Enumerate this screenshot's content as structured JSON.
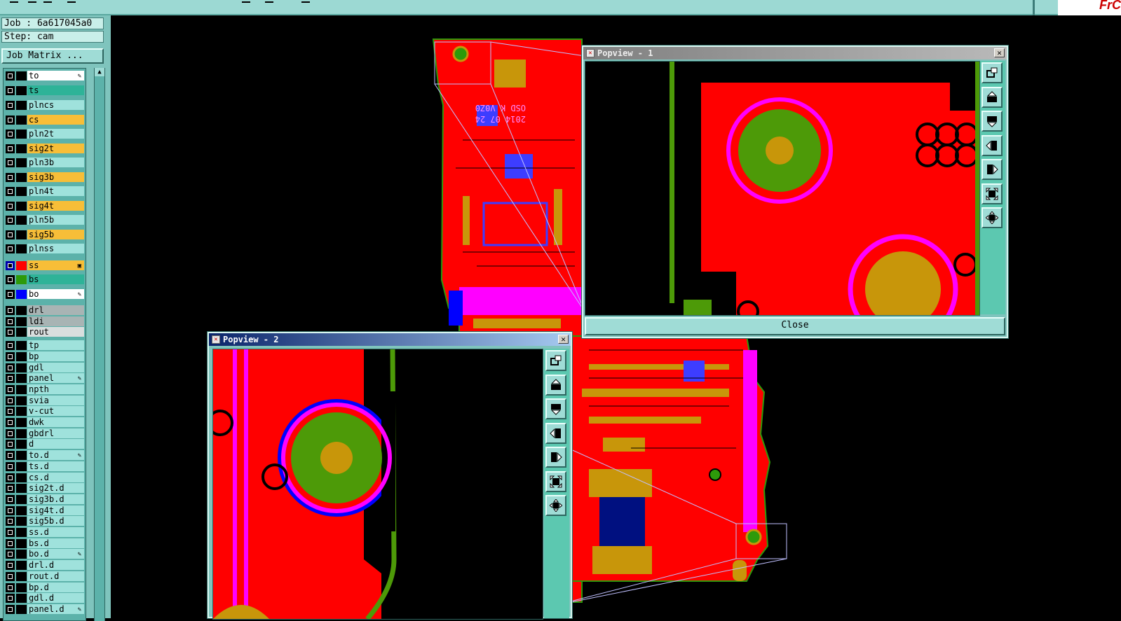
{
  "job_label": "Job : 6a617045a0",
  "step_label": "Step: cam",
  "job_matrix_button": "Job Matrix ...",
  "colors": {
    "panel": "#7fc4bd",
    "layer_default": "#9fe2dc",
    "signal_layer": "#f7be38",
    "selected_layer": "#2eb398",
    "board_red": "#ff0000",
    "pad_gold": "#c8960a",
    "green": "#4d9a08",
    "magenta": "#ff00ff"
  },
  "layers": [
    {
      "name": "to",
      "color": "white",
      "chip": "#000",
      "mark": "✎"
    },
    {
      "name": "ts",
      "color": "teal",
      "chip": "#000",
      "mark": ""
    },
    {
      "name": "plncs",
      "color": "default",
      "chip": "#000",
      "mark": ""
    },
    {
      "name": "cs",
      "color": "orange",
      "chip": "#000",
      "mark": ""
    },
    {
      "name": "pln2t",
      "color": "default",
      "chip": "#000",
      "mark": ""
    },
    {
      "name": "sig2t",
      "color": "orange",
      "chip": "#000",
      "mark": ""
    },
    {
      "name": "pln3b",
      "color": "default",
      "chip": "#000",
      "mark": ""
    },
    {
      "name": "sig3b",
      "color": "orange",
      "chip": "#000",
      "mark": ""
    },
    {
      "name": "pln4t",
      "color": "default",
      "chip": "#000",
      "mark": ""
    },
    {
      "name": "sig4t",
      "color": "orange",
      "chip": "#000",
      "mark": ""
    },
    {
      "name": "pln5b",
      "color": "default",
      "chip": "#000",
      "mark": ""
    },
    {
      "name": "sig5b",
      "color": "orange",
      "chip": "#000",
      "mark": ""
    },
    {
      "name": "plnss",
      "color": "default",
      "chip": "#000",
      "mark": ""
    },
    {
      "name": "ss",
      "color": "orange",
      "chip": "#ff0000",
      "mark": "▣",
      "active": true
    },
    {
      "name": "bs",
      "color": "teal",
      "chip": "#2d9a0a",
      "mark": ""
    },
    {
      "name": "bo",
      "color": "white",
      "chip": "#0000ff",
      "mark": "✎"
    },
    {
      "name": "drl",
      "color": "grey",
      "chip": "#000",
      "mark": ""
    },
    {
      "name": "ldi",
      "color": "grey",
      "chip": "#000",
      "mark": ""
    },
    {
      "name": "rout",
      "color": "lightgrey",
      "chip": "#000",
      "mark": ""
    },
    {
      "name": "tp",
      "color": "default",
      "chip": "#000",
      "mark": ""
    },
    {
      "name": "bp",
      "color": "default",
      "chip": "#000",
      "mark": ""
    },
    {
      "name": "gdl",
      "color": "default",
      "chip": "#000",
      "mark": ""
    },
    {
      "name": "panel",
      "color": "default",
      "chip": "#000",
      "mark": "✎"
    },
    {
      "name": "npth",
      "color": "default",
      "chip": "#000",
      "mark": ""
    },
    {
      "name": "svia",
      "color": "default",
      "chip": "#000",
      "mark": ""
    },
    {
      "name": "v-cut",
      "color": "default",
      "chip": "#000",
      "mark": ""
    },
    {
      "name": "dwk",
      "color": "default",
      "chip": "#000",
      "mark": ""
    },
    {
      "name": "gbdrl",
      "color": "default",
      "chip": "#000",
      "mark": ""
    },
    {
      "name": "d",
      "color": "default",
      "chip": "#000",
      "mark": ""
    },
    {
      "name": "to.d",
      "color": "default",
      "chip": "#000",
      "mark": "✎"
    },
    {
      "name": "ts.d",
      "color": "default",
      "chip": "#000",
      "mark": ""
    },
    {
      "name": "cs.d",
      "color": "default",
      "chip": "#000",
      "mark": ""
    },
    {
      "name": "sig2t.d",
      "color": "default",
      "chip": "#000",
      "mark": ""
    },
    {
      "name": "sig3b.d",
      "color": "default",
      "chip": "#000",
      "mark": ""
    },
    {
      "name": "sig4t.d",
      "color": "default",
      "chip": "#000",
      "mark": ""
    },
    {
      "name": "sig5b.d",
      "color": "default",
      "chip": "#000",
      "mark": ""
    },
    {
      "name": "ss.d",
      "color": "default",
      "chip": "#000",
      "mark": ""
    },
    {
      "name": "bs.d",
      "color": "default",
      "chip": "#000",
      "mark": ""
    },
    {
      "name": "bo.d",
      "color": "default",
      "chip": "#000",
      "mark": "✎"
    },
    {
      "name": "drl.d",
      "color": "default",
      "chip": "#000",
      "mark": ""
    },
    {
      "name": "rout.d",
      "color": "default",
      "chip": "#000",
      "mark": ""
    },
    {
      "name": "bp.d",
      "color": "default",
      "chip": "#000",
      "mark": ""
    },
    {
      "name": "gdl.d",
      "color": "default",
      "chip": "#000",
      "mark": ""
    },
    {
      "name": "panel.d",
      "color": "default",
      "chip": "#000",
      "mark": "✎"
    }
  ],
  "popview1": {
    "title": "Popview - 1",
    "close_label": "Close"
  },
  "popview2": {
    "title": "Popview - 2"
  },
  "board_text": {
    "line1": "OSD K V0Z0",
    "line2": "2014 07 24"
  },
  "tool_icons": [
    "zoom-home-icon",
    "pan-up-icon",
    "pan-down-icon",
    "pan-left-icon",
    "pan-right-icon",
    "zoom-fit-icon",
    "zoom-in-icon"
  ]
}
